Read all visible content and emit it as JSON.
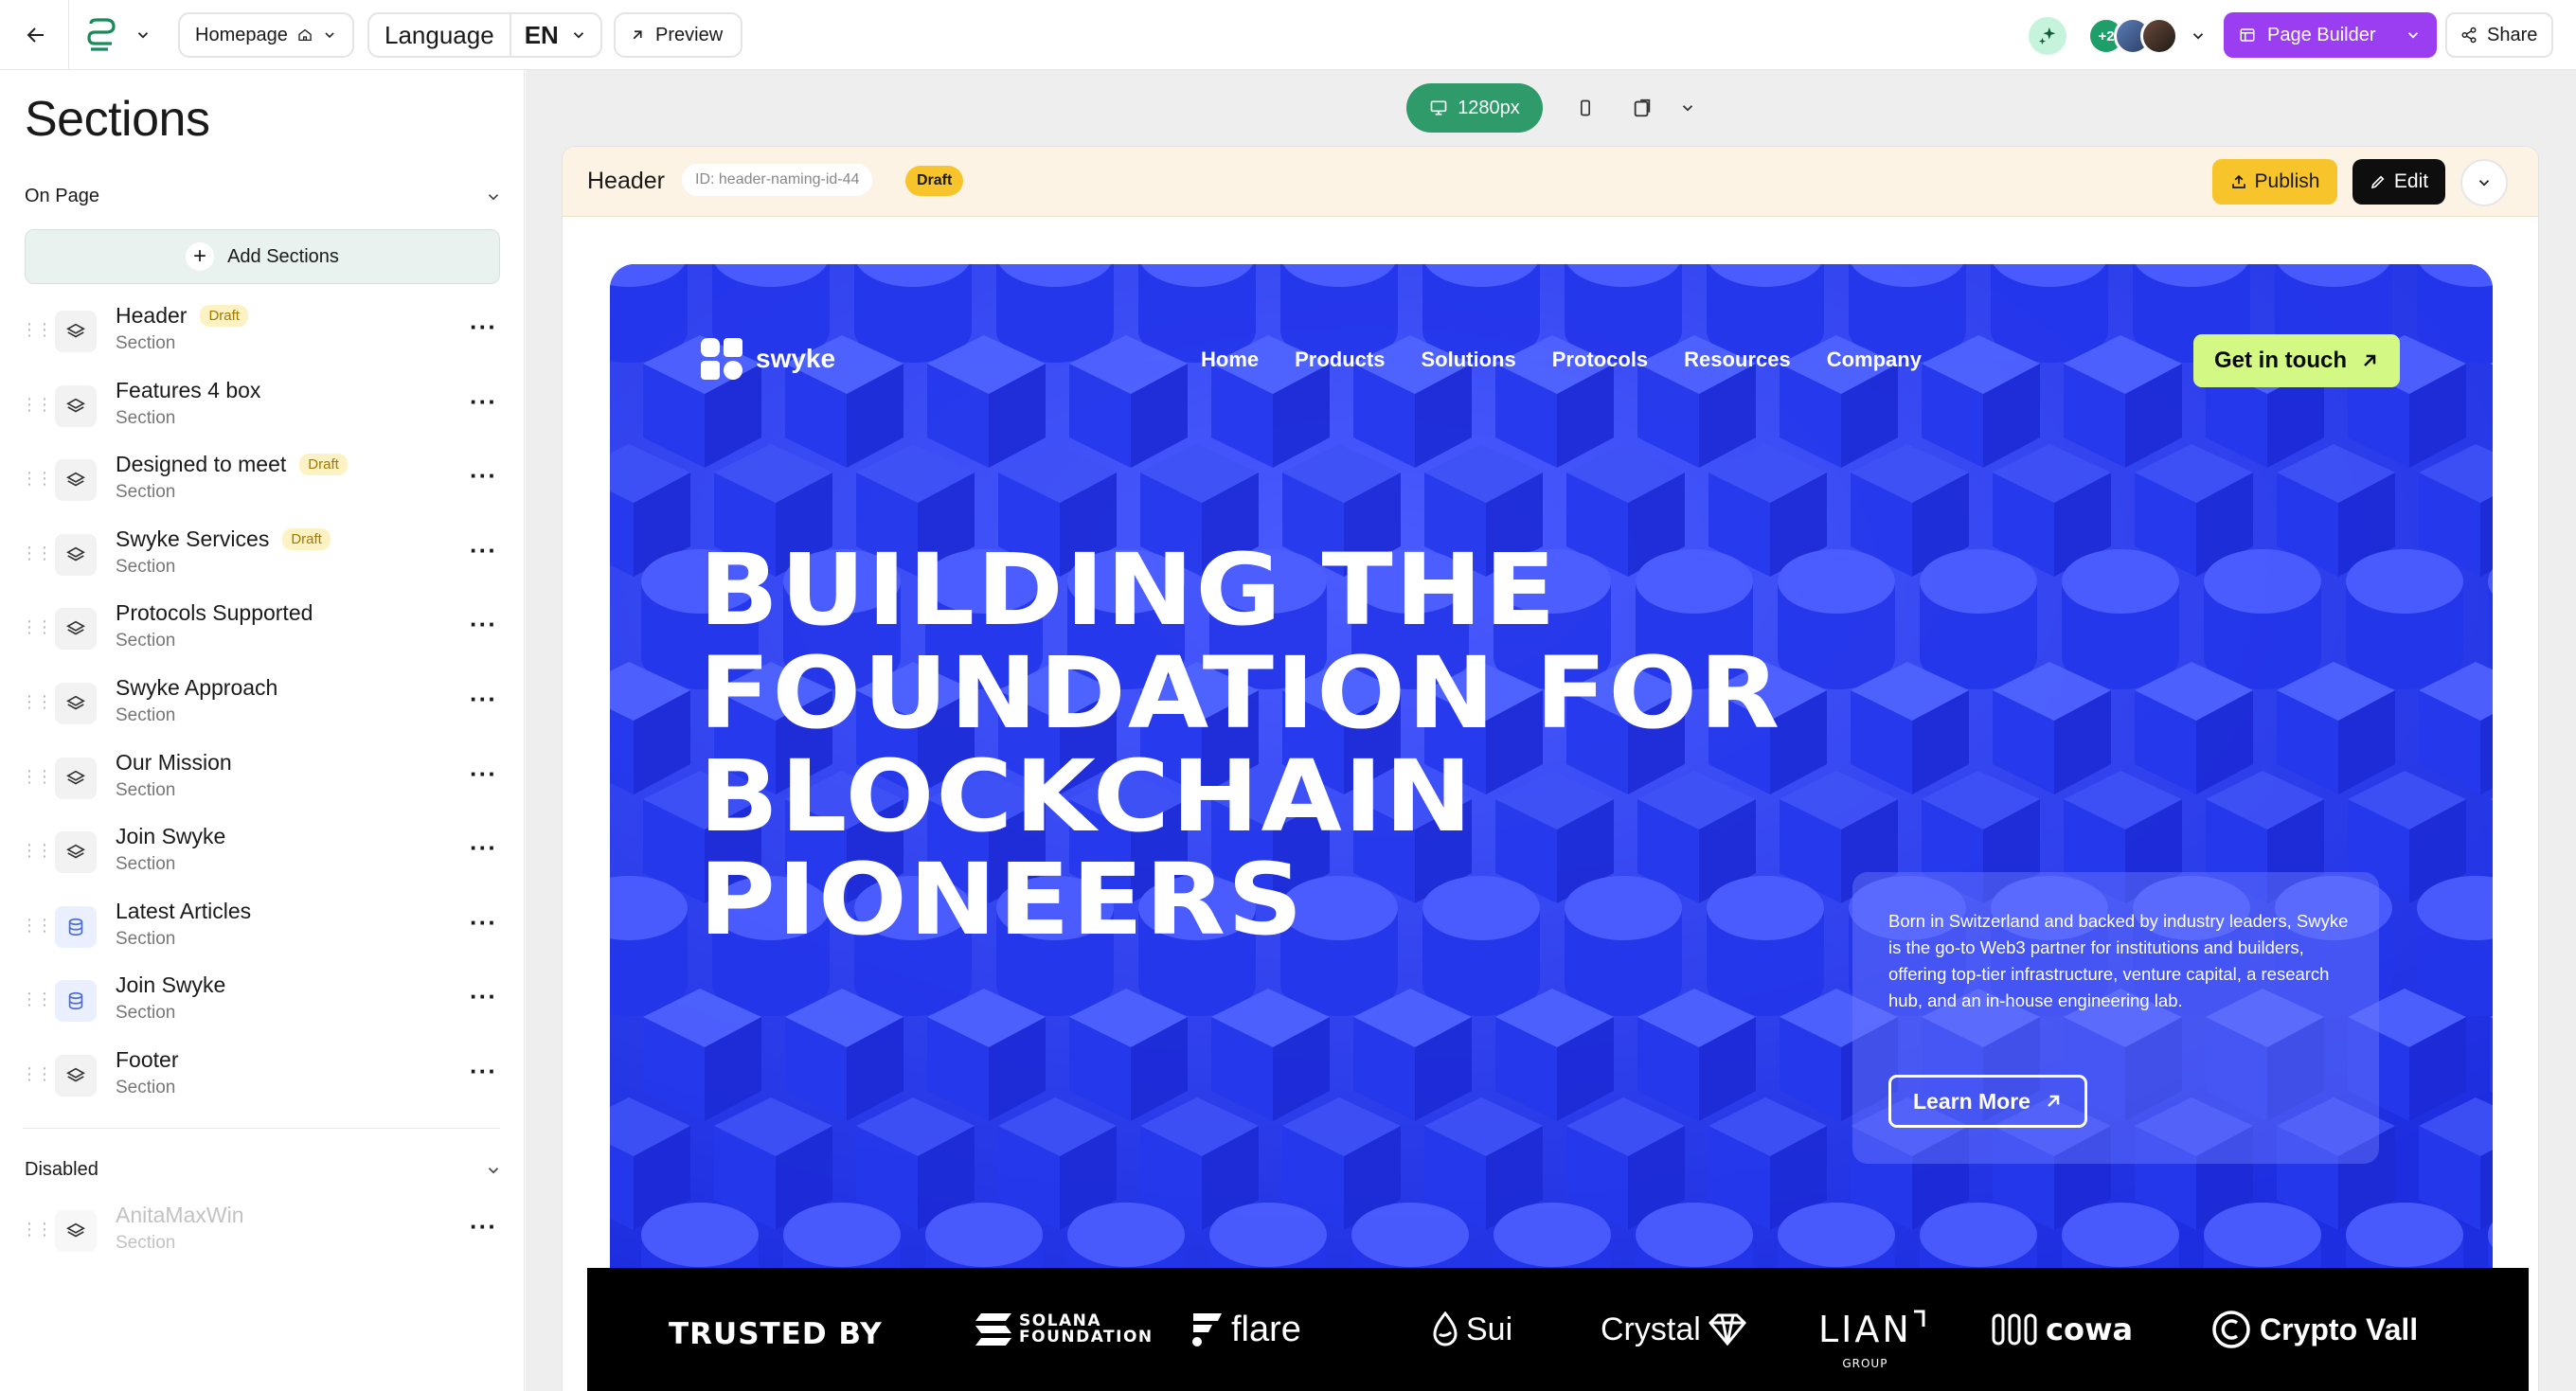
{
  "topbar": {
    "homepage_label": "Homepage",
    "language_label": "Language",
    "language_code": "EN",
    "preview_label": "Preview",
    "avatar_count": "+2",
    "page_builder_label": "Page Builder",
    "share_label": "Share"
  },
  "sidebar": {
    "title": "Sections",
    "on_page_label": "On Page",
    "add_sections_label": "Add Sections",
    "disabled_label": "Disabled",
    "sections": [
      {
        "name": "Header",
        "type": "Section",
        "badge": "Draft",
        "icon": "layers-icon"
      },
      {
        "name": "Features 4 box",
        "type": "Section",
        "badge": "",
        "icon": "layers-icon"
      },
      {
        "name": "Designed to meet",
        "type": "Section",
        "badge": "Draft",
        "icon": "layers-icon"
      },
      {
        "name": "Swyke Services",
        "type": "Section",
        "badge": "Draft",
        "icon": "layers-icon"
      },
      {
        "name": "Protocols Supported",
        "type": "Section",
        "badge": "",
        "icon": "layers-icon"
      },
      {
        "name": "Swyke Approach",
        "type": "Section",
        "badge": "",
        "icon": "layers-icon"
      },
      {
        "name": "Our Mission",
        "type": "Section",
        "badge": "",
        "icon": "layers-icon"
      },
      {
        "name": "Join Swyke",
        "type": "Section",
        "badge": "",
        "icon": "layers-icon"
      },
      {
        "name": "Latest Articles",
        "type": "Section",
        "badge": "",
        "icon": "database-icon"
      },
      {
        "name": "Join Swyke",
        "type": "Section",
        "badge": "",
        "icon": "database-icon"
      },
      {
        "name": "Footer",
        "type": "Section",
        "badge": "",
        "icon": "layers-icon"
      }
    ],
    "disabled_sections": [
      {
        "name": "AnitaMaxWin",
        "type": "Section"
      }
    ]
  },
  "canvas": {
    "viewport_label": "1280px",
    "section_header": {
      "title": "Header",
      "id_label": "ID: header-naming-id-44",
      "status": "Draft",
      "publish_label": "Publish",
      "edit_label": "Edit"
    }
  },
  "site": {
    "brand": "swyke",
    "nav": [
      "Home",
      "Products",
      "Solutions",
      "Protocols",
      "Resources",
      "Company"
    ],
    "cta_label": "Get in touch",
    "headline": [
      "BUILDING THE",
      "FOUNDATION FOR",
      "BLOCKCHAIN",
      "PIONEERS"
    ],
    "description": "Born in Switzerland and backed by industry leaders, Swyke is the go-to Web3 partner for institutions and builders, offering top-tier infrastructure, venture capital, a research hub, and an in-house engineering lab.",
    "learn_more_label": "Learn More",
    "accent_color": "#2a40f0",
    "cta_color": "#d3f984",
    "trusted_label": "TRUSTED BY",
    "partners": {
      "solana": [
        "SOLANA",
        "FOUNDATION"
      ],
      "flare": "flare",
      "sui": "Sui",
      "crystal": "Crystal",
      "lian": "LIAN",
      "lian_sub": "GROUP",
      "cowa": "cowa",
      "crypto": "Crypto Vall"
    }
  },
  "colors": {
    "page_builder": "#9b3df0",
    "viewport_active": "#2f9a6a",
    "publish": "#f8c42c",
    "draft_badge_bg": "#fdf2c4"
  }
}
